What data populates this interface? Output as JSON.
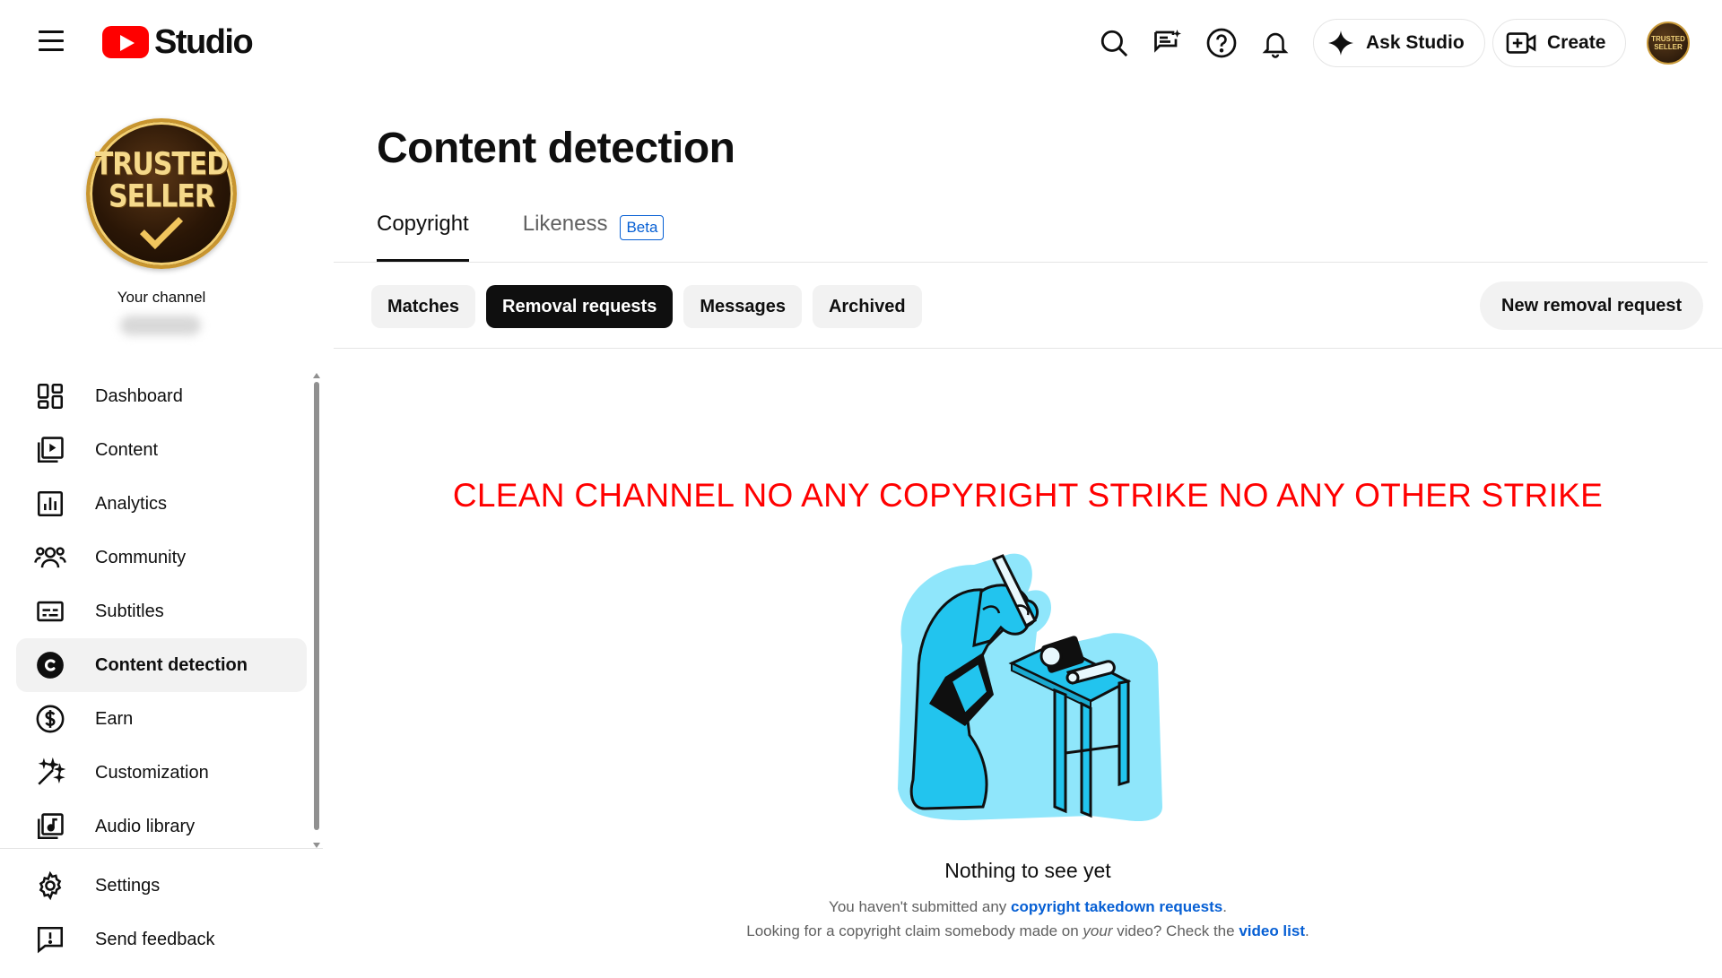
{
  "header": {
    "logo_text": "Studio",
    "ask_studio_label": "Ask Studio",
    "create_label": "Create",
    "avatar_text": "TRUSTED SELLER"
  },
  "sidebar": {
    "channel_badge_line1": "TRUSTED",
    "channel_badge_line2": "SELLER",
    "your_channel": "Your channel",
    "items": [
      {
        "label": "Dashboard",
        "icon": "dashboard-icon"
      },
      {
        "label": "Content",
        "icon": "content-icon"
      },
      {
        "label": "Analytics",
        "icon": "analytics-icon"
      },
      {
        "label": "Community",
        "icon": "community-icon"
      },
      {
        "label": "Subtitles",
        "icon": "subtitles-icon"
      },
      {
        "label": "Content detection",
        "icon": "copyright-icon",
        "active": true
      },
      {
        "label": "Earn",
        "icon": "dollar-icon"
      },
      {
        "label": "Customization",
        "icon": "magic-wand-icon"
      },
      {
        "label": "Audio library",
        "icon": "audio-library-icon"
      }
    ],
    "bottom_items": [
      {
        "label": "Settings",
        "icon": "gear-icon"
      },
      {
        "label": "Send feedback",
        "icon": "feedback-icon"
      }
    ]
  },
  "main": {
    "title": "Content detection",
    "tabs": [
      {
        "label": "Copyright",
        "active": true
      },
      {
        "label": "Likeness",
        "badge": "Beta"
      }
    ],
    "chips": [
      {
        "label": "Matches"
      },
      {
        "label": "Removal requests",
        "active": true
      },
      {
        "label": "Messages"
      },
      {
        "label": "Archived"
      }
    ],
    "new_request_label": "New removal request",
    "banner": "CLEAN CHANNEL NO ANY COPYRIGHT STRIKE NO ANY OTHER STRIKE",
    "empty": {
      "title": "Nothing to see yet",
      "line1_prefix": "You haven't submitted any ",
      "line1_link": "copyright takedown requests",
      "line1_suffix": ".",
      "line2_prefix": "Looking for a copyright claim somebody made on ",
      "line2_em": "your",
      "line2_middle": " video? Check the ",
      "line2_link": "video list",
      "line2_suffix": "."
    }
  },
  "colors": {
    "accent_blue": "#065fd4",
    "brand_red": "#ff0000",
    "banner_red": "#ff0000",
    "illustration_cyan": "#22c4ee"
  }
}
